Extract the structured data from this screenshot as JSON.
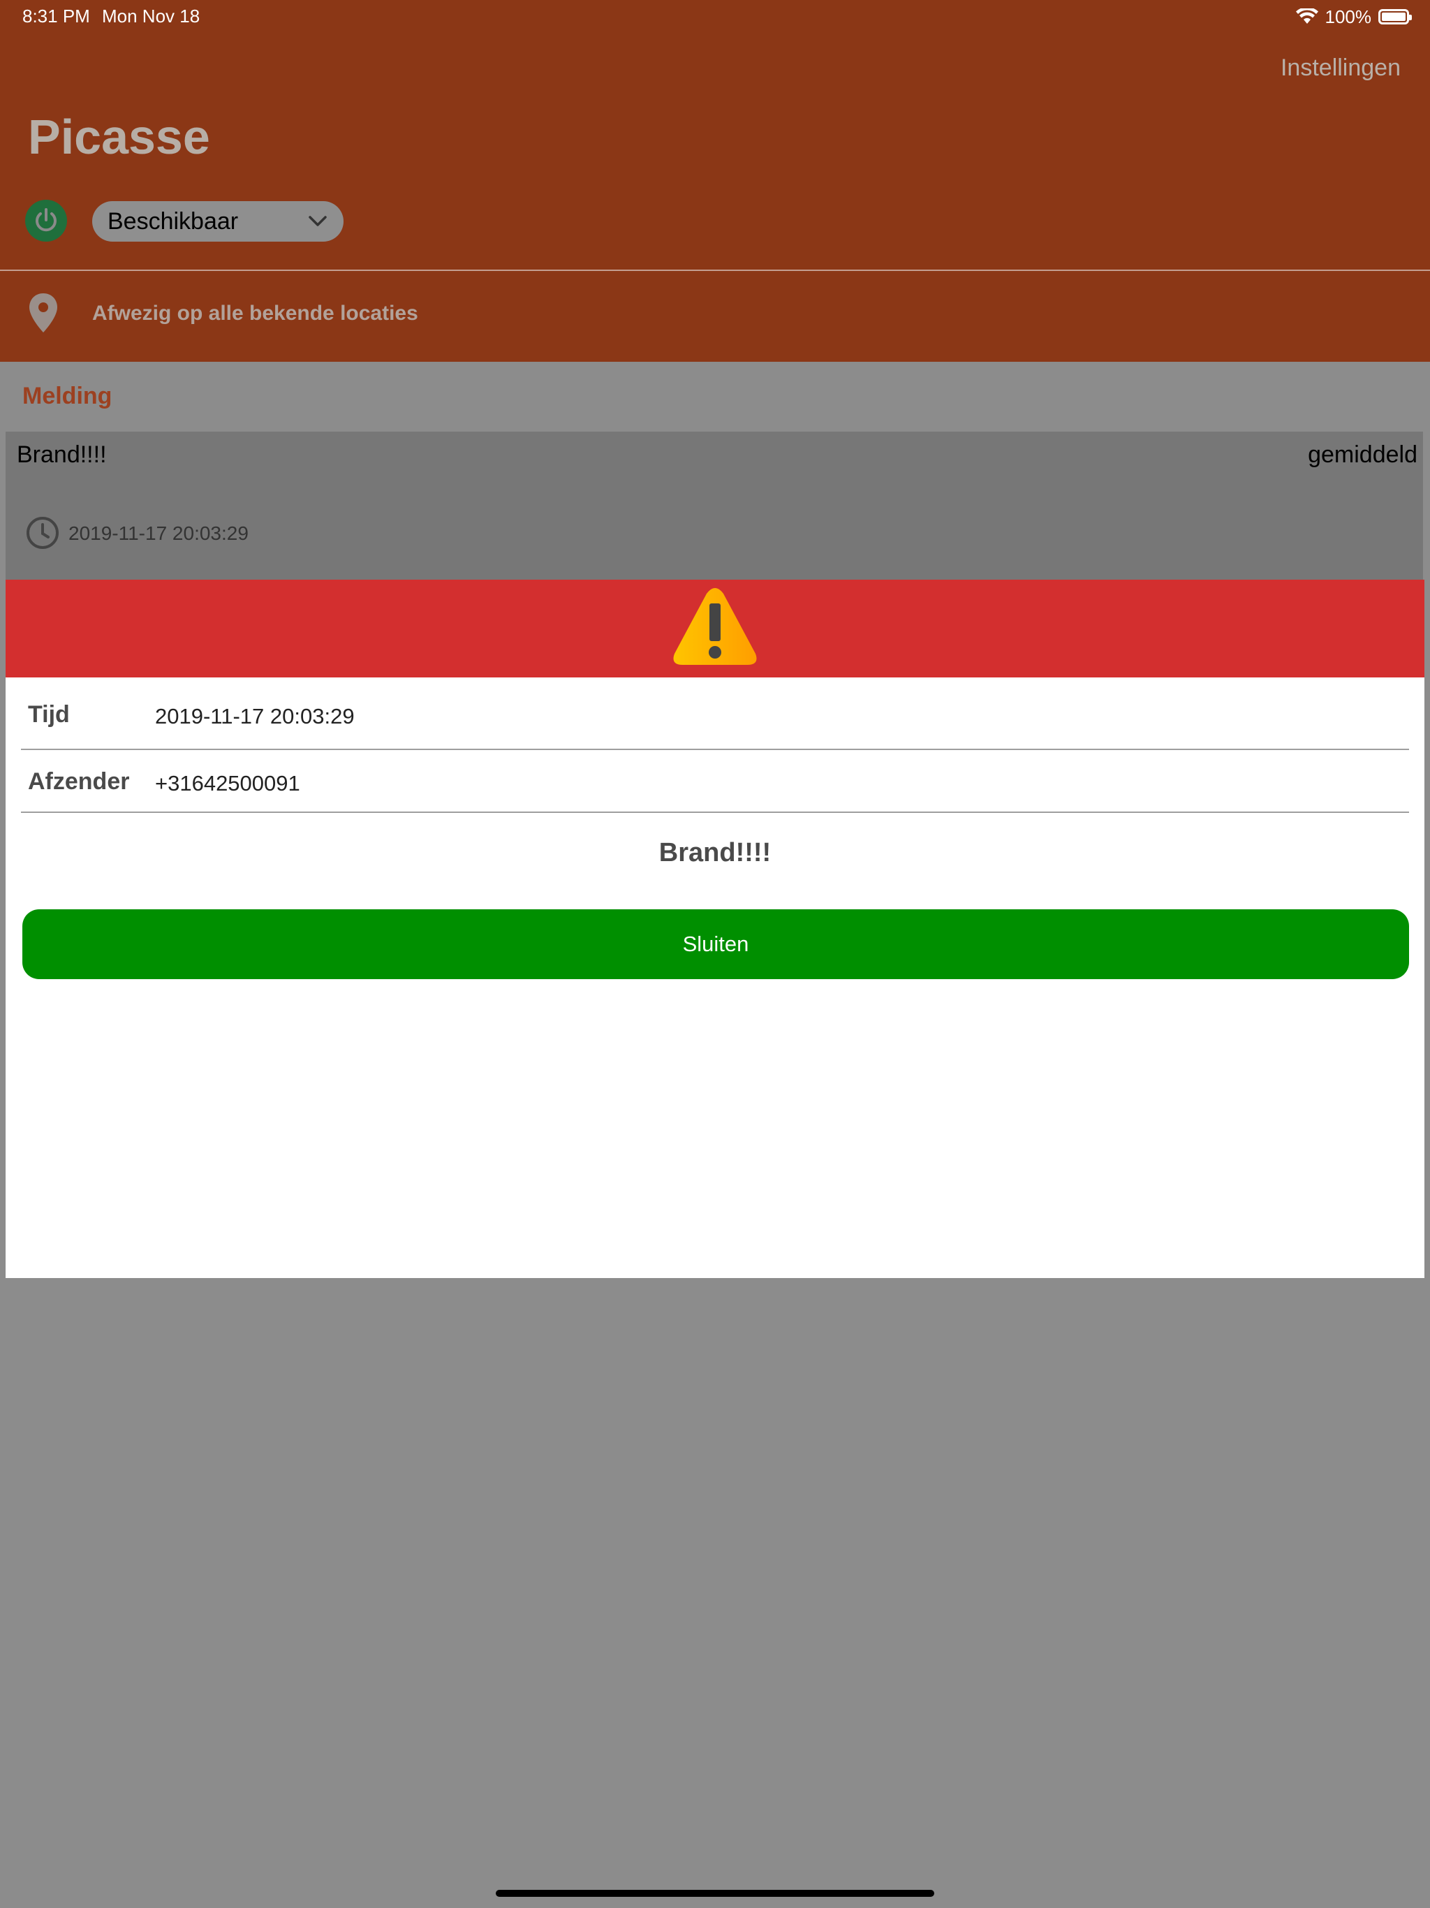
{
  "status_bar": {
    "time": "8:31 PM",
    "date": "Mon Nov 18",
    "battery": "100%"
  },
  "header": {
    "settings_label": "Instellingen",
    "title": "Picasse",
    "availability": "Beschikbaar",
    "location_status": "Afwezig op alle bekende locaties"
  },
  "section": {
    "title": "Melding"
  },
  "list_item": {
    "message": "Brand!!!!",
    "priority": "gemiddeld",
    "time": "2019-11-17 20:03:29"
  },
  "modal": {
    "time_label": "Tijd",
    "time_value": "2019-11-17 20:03:29",
    "sender_label": "Afzender",
    "sender_value": "+31642500091",
    "message": "Brand!!!!",
    "close_label": "Sluiten"
  },
  "colors": {
    "header_bg": "#8b3716",
    "modal_header_bg": "#d32f2f",
    "close_button_bg": "#008f00",
    "overlay_bg": "#8c8c8c"
  }
}
